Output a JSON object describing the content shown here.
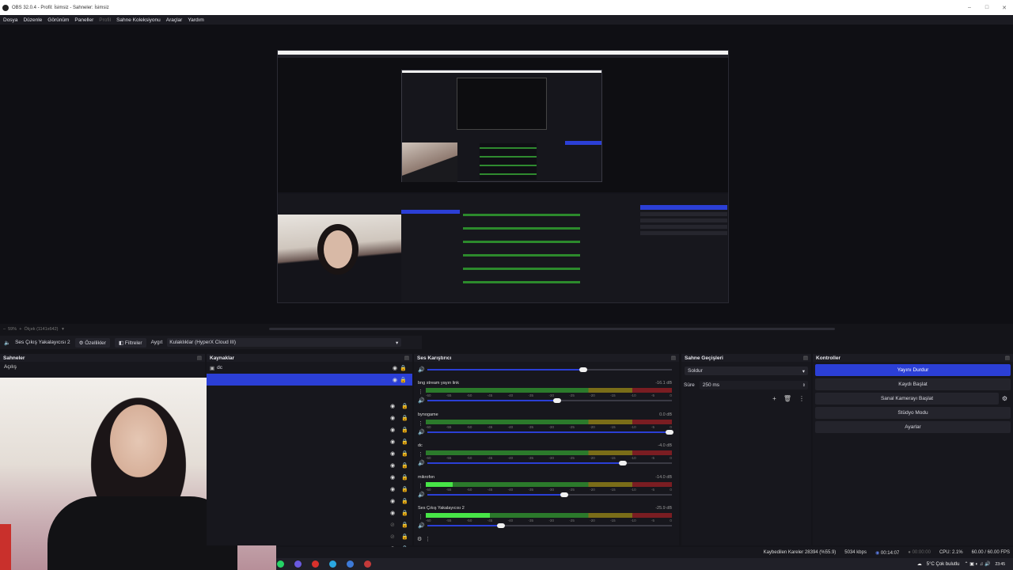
{
  "window": {
    "title": "OBS 32.0.4 - Profil: İsimsiz - Sahneler: İsimsiz"
  },
  "menu": [
    "Dosya",
    "Düzenle",
    "Görünüm",
    "Paneller",
    "Profil",
    "Sahne Koleksiyonu",
    "Araçlar",
    "Yardım"
  ],
  "preview_status": {
    "zoom": "59%",
    "scale_label": "Ölçek (1141x642)"
  },
  "source_toolbar": {
    "selected_source": "Ses Çıkış Yakalayıcısı 2",
    "properties": "Özellikler",
    "filters": "Filtreler",
    "device_label": "Aygıt",
    "device_value": "Kulaklıklar (HyperX Cloud III)"
  },
  "scenes": {
    "title": "Sahneler",
    "items": [
      "Açılış"
    ]
  },
  "sources": {
    "title": "Kaynaklar",
    "items": [
      {
        "name": "dc",
        "selected": true
      }
    ]
  },
  "mixer": {
    "title": "Ses Karıştırıcı",
    "ticks": [
      "-60",
      "-55",
      "-50",
      "-45",
      "-40",
      "-35",
      "-30",
      "-25",
      "-20",
      "-15",
      "-10",
      "-5",
      "0"
    ],
    "tracks": [
      {
        "name": "bng stream yayın link",
        "db": "-16.1 dB",
        "level": 0.0,
        "volume": 0.54
      },
      {
        "name": "bynogame",
        "db": "0.0 dB",
        "level": 0.0,
        "volume": 1.0
      },
      {
        "name": "dc",
        "db": "-4.0 dB",
        "level": 0.0,
        "volume": 0.81
      },
      {
        "name": "mikrofon",
        "db": "-14.0 dB",
        "level": 0.11,
        "volume": 0.57
      },
      {
        "name": "Ses Çıkış Yakalayıcısı 2",
        "db": "-25.9 dB",
        "level": 0.26,
        "volume": 0.31
      }
    ]
  },
  "transitions": {
    "title": "Sahne Geçişleri",
    "type": "Soldur",
    "duration_label": "Süre",
    "duration_value": "250 ms"
  },
  "controls": {
    "title": "Kontroller",
    "buttons": [
      "Yayını Durdur",
      "Kaydı Başlat",
      "Sanal Kamerayı Başlat",
      "Stüdyo Modu",
      "Ayarlar"
    ]
  },
  "status": {
    "dropped": "Kaybedilen Kareler 28394 (%55.9)",
    "bitrate": "5034 kbps",
    "stream_time": "00:14:07",
    "rec_time": "00:00:00",
    "cpu": "CPU: 2.1%",
    "fps": "60.00 / 60.00 FPS"
  },
  "taskbar": {
    "weather": "5°C Çok bulutlu",
    "time": "23:45"
  },
  "colors": {
    "accent": "#2b3fd6",
    "meter_green": "#47e547",
    "meter_yellow": "#7a6d18",
    "meter_red": "#7a1d22"
  }
}
